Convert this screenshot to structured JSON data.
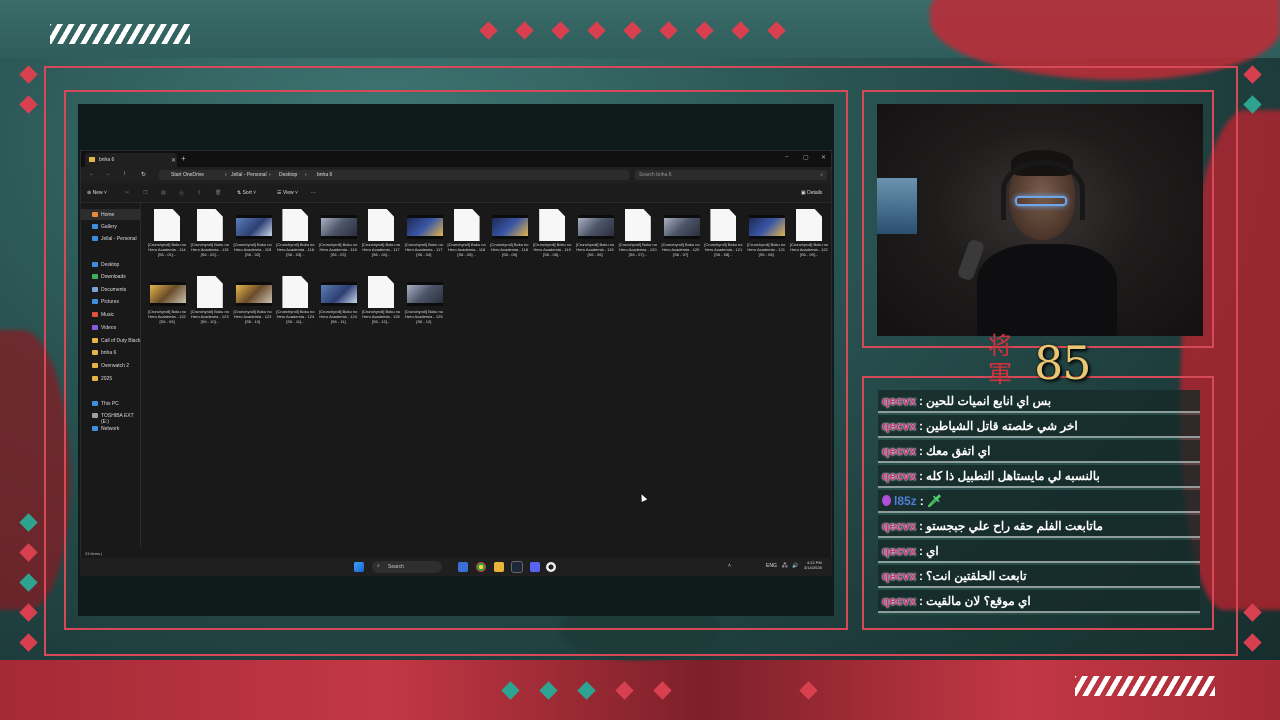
{
  "overlay": {
    "counter": "85",
    "kanji_top": "将",
    "kanji_bottom": "軍",
    "colors": {
      "accent": "#d64a57",
      "teal": "#2f5d5b",
      "gold": "#e8c673",
      "username": "#c4337a"
    }
  },
  "explorer": {
    "tab_title": "bnha 6",
    "new_tab_icon": "plus-icon",
    "window_controls": [
      "–",
      "▢",
      "✕"
    ],
    "breadcrumb": [
      "Start OneDrive",
      "Jellal - Personal",
      "Desktop",
      "bnha 6"
    ],
    "search_placeholder": "Search bnha 6",
    "toolbar": {
      "new": "New",
      "sort": "Sort",
      "view": "View",
      "more": "···",
      "details": "Details"
    },
    "sidebar": [
      {
        "label": "Home",
        "icon": "home-icon",
        "color": "#e88a3a",
        "selected": true
      },
      {
        "label": "Gallery",
        "icon": "gallery-icon",
        "color": "#3b8fe0"
      },
      {
        "label": "Jellal - Personal",
        "icon": "cloud-icon",
        "color": "#3b8fe0"
      },
      {
        "label": "Desktop",
        "icon": "desktop-icon",
        "color": "#3b8fe0"
      },
      {
        "label": "Downloads",
        "icon": "download-icon",
        "color": "#3bb35a"
      },
      {
        "label": "Documents",
        "icon": "documents-icon",
        "color": "#7aa2d8"
      },
      {
        "label": "Pictures",
        "icon": "pictures-icon",
        "color": "#3b8fe0"
      },
      {
        "label": "Music",
        "icon": "music-icon",
        "color": "#e0533b"
      },
      {
        "label": "Videos",
        "icon": "videos-icon",
        "color": "#8a5be0"
      },
      {
        "label": "Call of Duty  Black",
        "icon": "folder-icon",
        "color": "#e6b54a"
      },
      {
        "label": "bnha 6",
        "icon": "folder-icon",
        "color": "#e6b54a"
      },
      {
        "label": "Overwatch 2",
        "icon": "folder-icon",
        "color": "#e6b54a"
      },
      {
        "label": "2025",
        "icon": "folder-icon",
        "color": "#e6b54a"
      },
      {
        "label": "This PC",
        "icon": "pc-icon",
        "color": "#3b8fe0"
      },
      {
        "label": "TOSHIBA EXT (E:)",
        "icon": "drive-icon",
        "color": "#9aa0a6"
      },
      {
        "label": "Network",
        "icon": "network-icon",
        "color": "#3b8fe0"
      }
    ],
    "files": [
      {
        "kind": "blank",
        "name": "[Crunchyroll] Boku no Hero Academia - 114 [S6 - 01]..."
      },
      {
        "kind": "blank",
        "name": "[Crunchyroll] Boku no Hero Academia - 115 [S6 - 02]..."
      },
      {
        "kind": "video",
        "variant": "",
        "name": "[Crunchyroll] Boku no Hero Academia - 115 [S6 - 02]"
      },
      {
        "kind": "blank",
        "name": "[Crunchyroll] Boku no Hero Academia - 116 [S6 - 03]..."
      },
      {
        "kind": "video",
        "variant": "v3",
        "name": "[Crunchyroll] Boku no Hero Academia - 116 [S6 - 03]"
      },
      {
        "kind": "blank",
        "name": "[Crunchyroll] Boku no Hero Academia - 117 [S6 - 04]..."
      },
      {
        "kind": "video",
        "variant": "v2",
        "name": "[Crunchyroll] Boku no Hero Academia - 117 [S6 - 04]"
      },
      {
        "kind": "blank",
        "name": "[Crunchyroll] Boku no Hero Academia - 118 [S6 - 05]..."
      },
      {
        "kind": "video",
        "variant": "v2",
        "name": "[Crunchyroll] Boku no Hero Academia - 118 [S6 - 05]"
      },
      {
        "kind": "blank",
        "name": "[Crunchyroll] Boku no Hero Academia - 119 [S6 - 06]..."
      },
      {
        "kind": "video",
        "variant": "v3",
        "name": "[Crunchyroll] Boku no Hero Academia - 119 [S6 - 06]"
      },
      {
        "kind": "blank",
        "name": "[Crunchyroll] Boku no Hero Academia - 120 [S6 - 07]..."
      },
      {
        "kind": "video",
        "variant": "v3",
        "name": "[Crunchyroll] Boku no Hero Academia - 120 [S6 - 07]"
      },
      {
        "kind": "blank",
        "name": "[Crunchyroll] Boku no Hero Academia - 121 [S6 - 08]..."
      },
      {
        "kind": "video",
        "variant": "v2",
        "name": "[Crunchyroll] Boku no Hero Academia - 121 [S6 - 08]"
      },
      {
        "kind": "blank",
        "name": "[Crunchyroll] Boku no Hero Academia - 122 [S6 - 09]..."
      },
      {
        "kind": "video",
        "variant": "v4",
        "name": "[Crunchyroll] Boku no Hero Academia - 122 [S6 - 09]"
      },
      {
        "kind": "blank",
        "name": "[Crunchyroll] Boku no Hero Academia - 123 [S6 - 10]..."
      },
      {
        "kind": "video",
        "variant": "v4",
        "name": "[Crunchyroll] Boku no Hero Academia - 123 [S6 - 10]"
      },
      {
        "kind": "blank",
        "name": "[Crunchyroll] Boku no Hero Academia - 124 [S6 - 11]..."
      },
      {
        "kind": "video",
        "variant": "",
        "name": "[Crunchyroll] Boku no Hero Academia - 124 [S6 - 11]"
      },
      {
        "kind": "blank",
        "name": "[Crunchyroll] Boku no Hero Academia - 125 [S6 - 12]..."
      },
      {
        "kind": "video",
        "variant": "v3",
        "name": "[Crunchyroll] Boku no Hero Academia - 125 [S6 - 12]"
      }
    ],
    "status": "23 items  |"
  },
  "taskbar": {
    "search_label": "Search",
    "lang": "ENG",
    "time": "4:22 PM",
    "date": "3/14/2026"
  },
  "chat": [
    {
      "user": "qecvx",
      "text": "بس اي انابع انميات للحين"
    },
    {
      "user": "qecvx",
      "text": "اخر شي خلصته قاتل الشياطين"
    },
    {
      "user": "qecvx",
      "text": "اي اتفق معك"
    },
    {
      "user": "qecvx",
      "text": "بالنسبه لي مايستاهل التطبيل ذا كله"
    },
    {
      "user": "l85z",
      "text": "🗡",
      "badge": true,
      "blue": true
    },
    {
      "user": "qecvx",
      "text": "ماتابعت الفلم حقه راح علي جبجستو"
    },
    {
      "user": "qecvx",
      "text": "اي"
    },
    {
      "user": "qecvx",
      "text": "تابعت الحلقتين انت؟"
    },
    {
      "user": "qecvx",
      "text": "اي موقع؟ لان مالقيت"
    }
  ]
}
